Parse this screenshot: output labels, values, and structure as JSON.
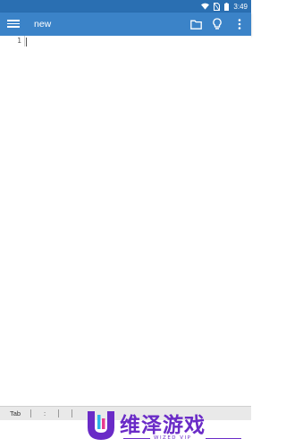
{
  "status_bar": {
    "time": "3:49"
  },
  "app_bar": {
    "title": "new",
    "icons": [
      "menu-icon",
      "folder-icon",
      "lightbulb-icon",
      "more-vert-icon"
    ]
  },
  "editor": {
    "line_numbers": [
      "1"
    ]
  },
  "bottom_bar": {
    "keys": [
      "Tab",
      ":"
    ]
  },
  "watermark": {
    "text": "维泽游戏",
    "subtext": "WIZED VIP"
  },
  "colors": {
    "status_bar": "#2a6fb2",
    "app_bar": "#3b83c8",
    "watermark": "#6a2bc7"
  }
}
